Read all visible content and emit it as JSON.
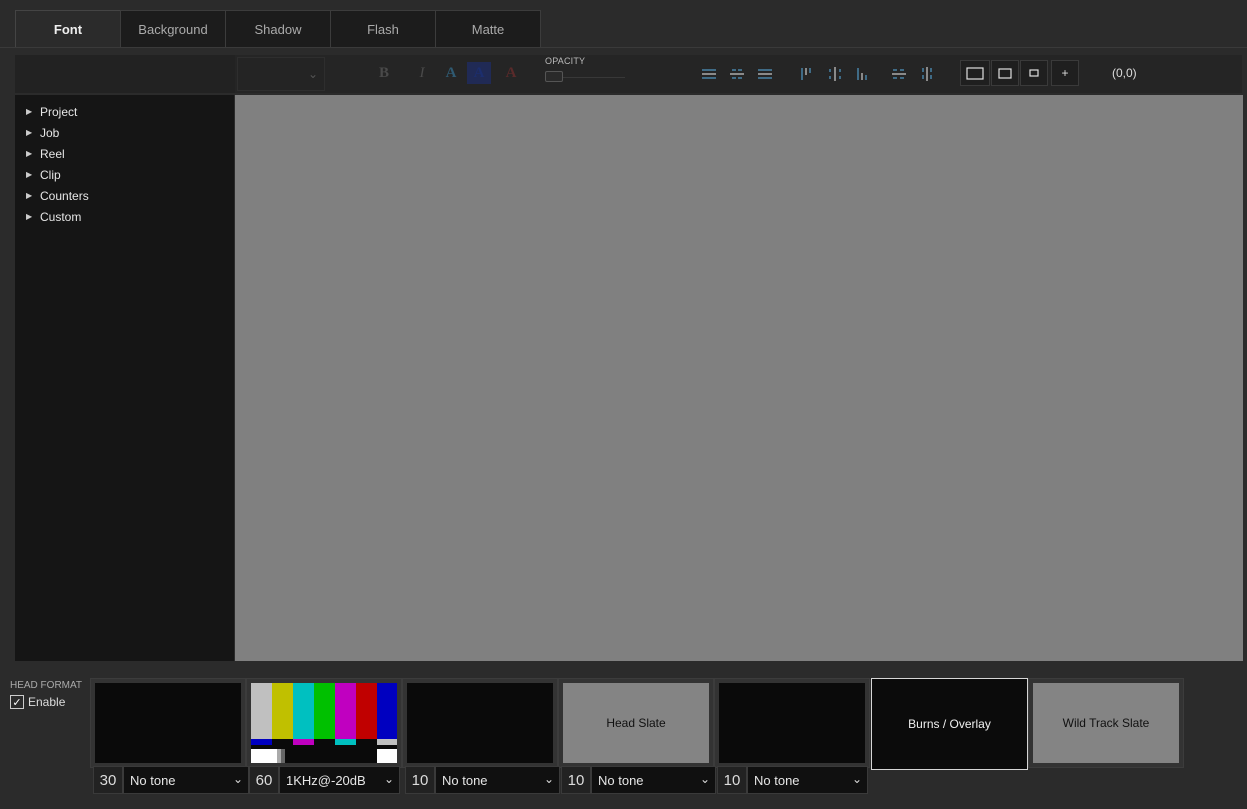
{
  "tabs": [
    "Font",
    "Background",
    "Shadow",
    "Flash",
    "Matte"
  ],
  "active_tab": "Font",
  "toolbar": {
    "opacity_label": "OPACITY",
    "coord": "(0,0)",
    "plus_label": "+"
  },
  "tree": [
    "Project",
    "Job",
    "Reel",
    "Clip",
    "Counters",
    "Custom"
  ],
  "bottom": {
    "head_format_label": "HEAD FORMAT",
    "enable_label": "Enable",
    "enable_checked": true,
    "cards": [
      {
        "label": ""
      },
      {
        "label": ""
      },
      {
        "label": ""
      },
      {
        "label": "Head Slate"
      },
      {
        "label": ""
      },
      {
        "label": "Burns / Overlay"
      },
      {
        "label": "Wild Track Slate"
      }
    ],
    "tones": [
      {
        "num": "30",
        "tone": "No tone"
      },
      {
        "num": "60",
        "tone": "1KHz@-20dB"
      },
      {
        "num": "10",
        "tone": "No tone"
      },
      {
        "num": "10",
        "tone": "No tone"
      },
      {
        "num": "10",
        "tone": "No tone"
      }
    ]
  },
  "colors": {
    "canvas": "#808080",
    "accent": "#3f6b86"
  }
}
